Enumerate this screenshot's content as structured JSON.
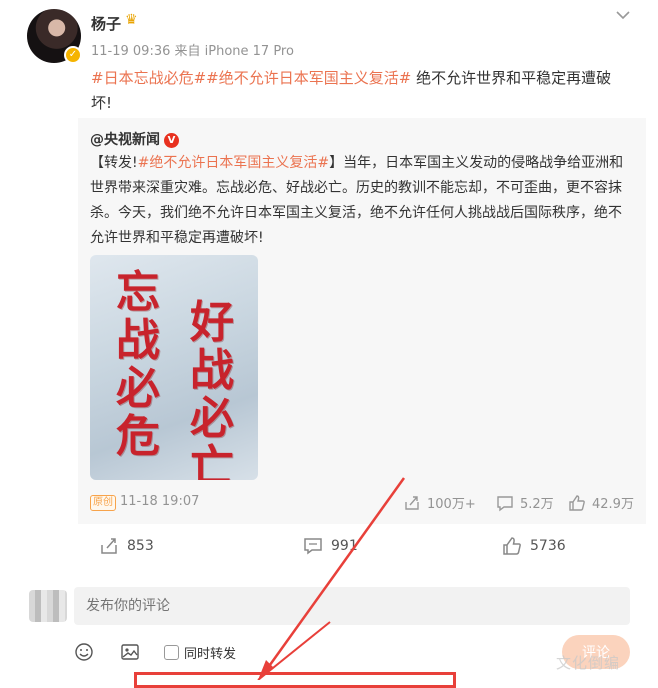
{
  "post": {
    "username": "杨子",
    "meta": "11-19 09:36 来自 iPhone 17 Pro",
    "tag1": "#日本忘战必危#",
    "tag2": "#绝不允许日本军国主义复活#",
    "text": "绝不允许世界和平稳定再遭破坏!"
  },
  "repost": {
    "author": "@央视新闻",
    "prefix": "【转发!",
    "tag": "#绝不允许日本军国主义复活#",
    "body": "】当年，日本军国主义发动的侵略战争给亚洲和世界带来深重灾难。忘战必危、好战必亡。历史的教训不能忘却，不可歪曲，更不容抹杀。今天，我们绝不允许日本军国主义复活，绝不允许任何人挑战战后国际秩序，绝不允许世界和平稳定再遭破坏!",
    "poster_col1": "忘战必危",
    "poster_col2": "好战必亡",
    "yuan_label": "原创",
    "date": "11-18 19:07",
    "share_count": "100万+",
    "comment_count": "5.2万",
    "like_count": "42.9万"
  },
  "actions": {
    "share": "853",
    "comment": "991",
    "like": "5736"
  },
  "comment_box": {
    "placeholder": "发布你的评论",
    "also_repost": "同时转发",
    "send": "评论"
  },
  "watermark": "文化倒编",
  "colors": {
    "accent": "#eb7350",
    "highlight_box": "#e8403a"
  }
}
